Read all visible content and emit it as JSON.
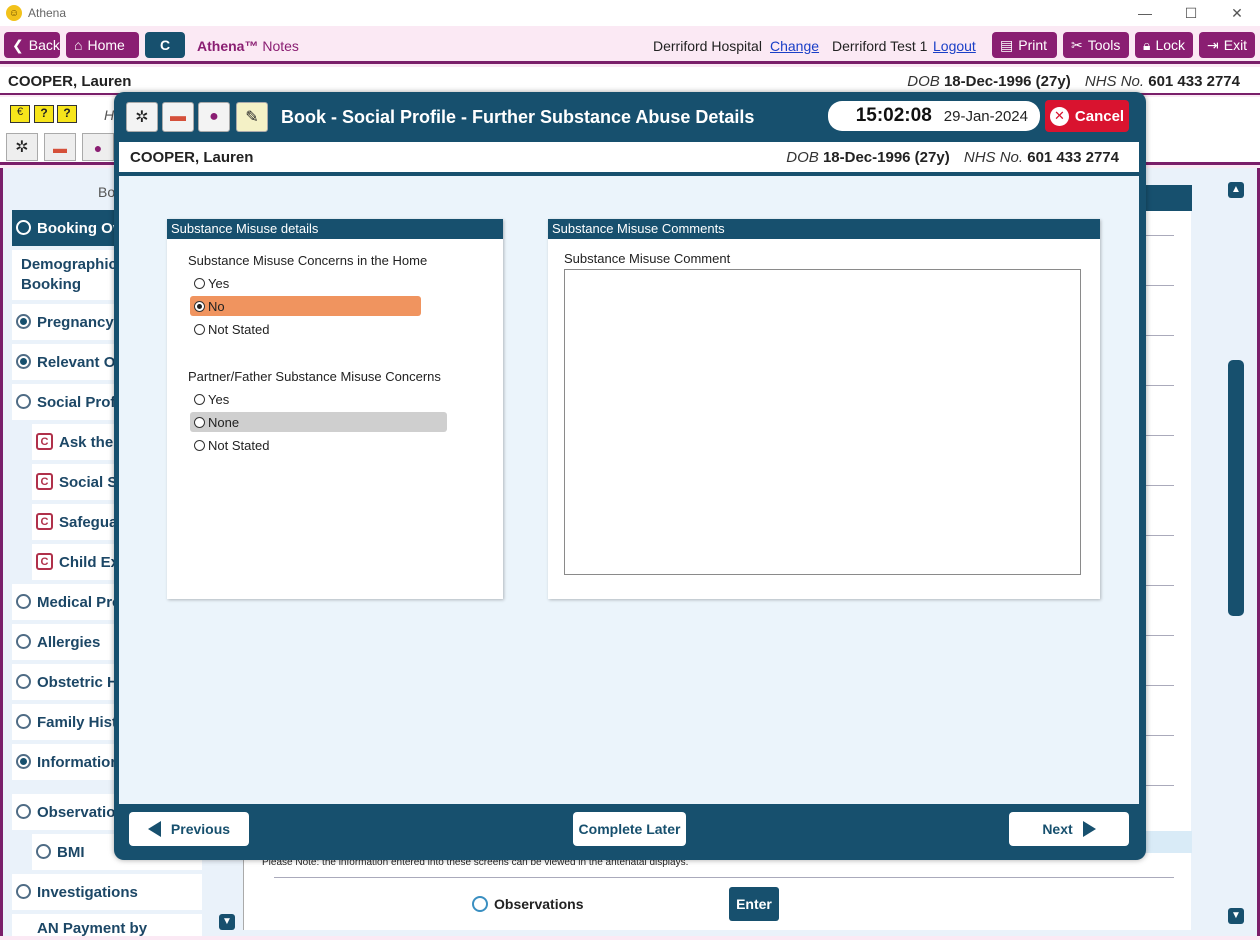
{
  "app": {
    "title": "Athena",
    "minimize": "—",
    "maximize": "☐",
    "close": "✕"
  },
  "toolbar": {
    "back": "Back",
    "home": "Home",
    "c_label": "C",
    "brand": "Athena™",
    "brand_sub": "Notes",
    "hospital": "Derriford Hospital",
    "change": "Change",
    "user": "Derriford Test 1",
    "logout": "Logout",
    "print": "Print",
    "tools": "Tools",
    "lock": "Lock",
    "exit": "Exit"
  },
  "patient": {
    "name": "COOPER, Lauren",
    "dob_label": "DOB",
    "dob": "18-Dec-1996 (27y)",
    "nhs_label": "NHS No.",
    "nhs": "601 433 2774"
  },
  "background": {
    "side_title": "Bo",
    "row_text": "H",
    "nav": [
      {
        "label": "Booking Ov",
        "state": "active"
      },
      {
        "label": "Demographics Booking",
        "state": "plain"
      },
      {
        "label": "Pregnancy I",
        "state": "filled"
      },
      {
        "label": "Relevant Ot",
        "state": "filled"
      },
      {
        "label": "Social Profil",
        "state": "empty"
      },
      {
        "label": "Ask the",
        "state": "c"
      },
      {
        "label": "Social Se",
        "state": "c"
      },
      {
        "label": "Safegua",
        "state": "c"
      },
      {
        "label": "Child Exp",
        "state": "c"
      },
      {
        "label": "Medical Pro",
        "state": "empty"
      },
      {
        "label": "Allergies",
        "state": "empty"
      },
      {
        "label": "Obstetric H",
        "state": "empty"
      },
      {
        "label": "Family Histo",
        "state": "empty"
      },
      {
        "label": "Information",
        "state": "filled"
      },
      {
        "label": "Observation",
        "state": "empty"
      },
      {
        "label": "BMI",
        "state": "empty"
      },
      {
        "label": "Investigations",
        "state": "empty"
      },
      {
        "label": "AN Payment by",
        "state": "plain"
      }
    ],
    "note": "Please Note: the information entered into these screens can be viewed in the antenatal displays.",
    "observations": "Observations",
    "enter": "Enter"
  },
  "modal": {
    "title": "Book - Social Profile - Further Substance Abuse Details",
    "time": "15:02:08",
    "date": "29-Jan-2024",
    "cancel": "Cancel",
    "left_panel": {
      "header": "Substance Misuse details",
      "q1": {
        "label": "Substance Misuse Concerns in the Home",
        "options": [
          "Yes",
          "No",
          "Not Stated"
        ],
        "selected": "No"
      },
      "q2": {
        "label": "Partner/Father Substance Misuse Concerns",
        "options": [
          "Yes",
          "None",
          "Not Stated"
        ],
        "highlighted": "None"
      }
    },
    "right_panel": {
      "header": "Substance Misuse Comments",
      "field_label": "Substance Misuse Comment",
      "value": ""
    },
    "footer": {
      "previous": "Previous",
      "complete_later": "Complete Later",
      "next": "Next"
    }
  },
  "colors": {
    "brand": "#8a1e72",
    "primary": "#17506e",
    "cancel": "#d9132f",
    "selected_option": "#f0945f"
  }
}
